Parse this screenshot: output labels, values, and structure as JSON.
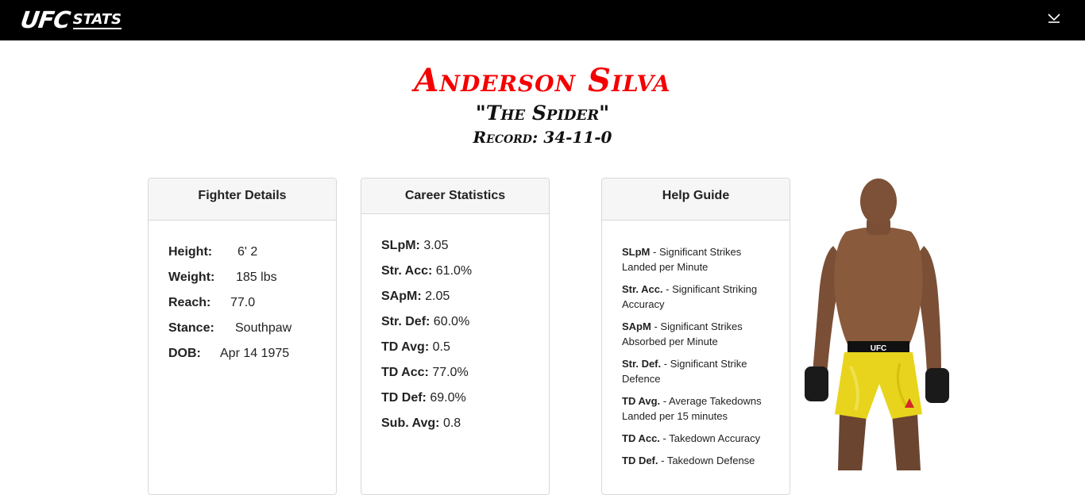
{
  "nav": {
    "logo_main": "UFC",
    "logo_sub": "STATS",
    "menu_icon": "chevron-down-icon"
  },
  "fighter": {
    "name": "Anderson Silva",
    "nickname": "\"The Spider\"",
    "record": "Record: 34-11-0"
  },
  "details": {
    "title": "Fighter Details",
    "rows": [
      {
        "label": "Height:",
        "value": "6' 2"
      },
      {
        "label": "Weight:",
        "value": "185 lbs"
      },
      {
        "label": "Reach:",
        "value": "77.0"
      },
      {
        "label": "Stance:",
        "value": "Southpaw"
      },
      {
        "label": "DOB:",
        "value": "Apr 14 1975"
      }
    ]
  },
  "career": {
    "title": "Career Statistics",
    "rows": [
      {
        "label": "SLpM:",
        "value": "3.05"
      },
      {
        "label": "Str. Acc:",
        "value": "61.0%"
      },
      {
        "label": "SApM:",
        "value": "2.05"
      },
      {
        "label": "Str. Def:",
        "value": "60.0%"
      },
      {
        "label": "TD Avg:",
        "value": "0.5"
      },
      {
        "label": "TD Acc:",
        "value": "77.0%"
      },
      {
        "label": "TD Def:",
        "value": "69.0%"
      },
      {
        "label": "Sub. Avg:",
        "value": "0.8"
      }
    ]
  },
  "help": {
    "title": "Help Guide",
    "items": [
      {
        "term": "SLpM",
        "desc": "Significant Strikes Landed per Minute"
      },
      {
        "term": "Str. Acc.",
        "desc": "Significant Striking Accuracy"
      },
      {
        "term": "SApM",
        "desc": "Significant Strikes Absorbed per Minute"
      },
      {
        "term": "Str. Def.",
        "desc": "Significant Strike Defence"
      },
      {
        "term": "TD Avg.",
        "desc": "Average Takedowns Landed per 15 minutes"
      },
      {
        "term": "TD Acc.",
        "desc": "Takedown Accuracy"
      },
      {
        "term": "TD Def.",
        "desc": "Takedown Defense"
      }
    ]
  },
  "colors": {
    "accent": "#f50000",
    "nav_bg": "#000000",
    "shorts": "#e8d41c"
  }
}
